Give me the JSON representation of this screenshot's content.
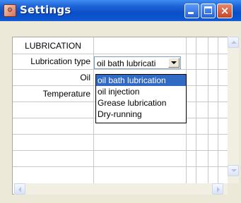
{
  "window": {
    "title": "Settings",
    "app_icon": "application-icon",
    "icon_text": "⚙"
  },
  "title_buttons": {
    "minimize": "minimize-icon",
    "maximize": "maximize-icon",
    "close": "close-icon",
    "close_glyph": "×"
  },
  "grid": {
    "section_header": "LUBRICATION",
    "rows": [
      {
        "label": "Lubrication type"
      },
      {
        "label": "Oil"
      },
      {
        "label": "Temperature"
      }
    ],
    "combo_value": "oil bath lubricati"
  },
  "dropdown": {
    "options": [
      "oil bath lubrication",
      "oil injection",
      "Grease lubrication",
      "Dry-running"
    ],
    "selected_index": 0
  },
  "colors": {
    "titlebar": "#0a4fc7",
    "selection": "#316ac5",
    "close_button": "#c5452a"
  }
}
